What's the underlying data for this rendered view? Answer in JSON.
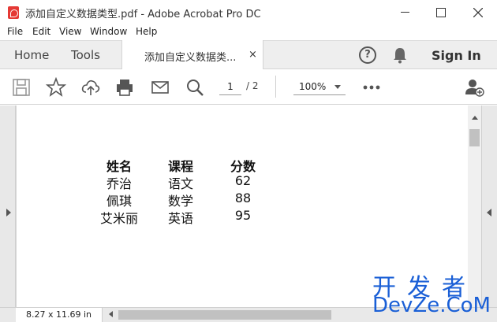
{
  "window": {
    "title": "添加自定义数据类型.pdf - Adobe Acrobat Pro DC"
  },
  "menu": {
    "items": [
      "File",
      "Edit",
      "View",
      "Window",
      "Help"
    ]
  },
  "tabs": {
    "home": "Home",
    "tools": "Tools",
    "document": "添加自定义数据类...",
    "close_glyph": "×",
    "help_glyph": "?",
    "sign_in": "Sign In"
  },
  "toolbar": {
    "current_page": "1",
    "page_total": "/ 2",
    "zoom": "100%"
  },
  "document": {
    "headers": [
      "姓名",
      "课程",
      "分数"
    ],
    "rows": [
      [
        "乔治",
        "语文",
        "62"
      ],
      [
        "佩琪",
        "数学",
        "88"
      ],
      [
        "艾米丽",
        "英语",
        "95"
      ]
    ]
  },
  "status": {
    "page_size": "8.27 x 11.69 in"
  },
  "watermark": {
    "top": "开发者",
    "bottom": "DevZe.CoM"
  },
  "colors": {
    "acrobat_red": "#e53935",
    "watermark_blue": "#1a5fd6"
  }
}
